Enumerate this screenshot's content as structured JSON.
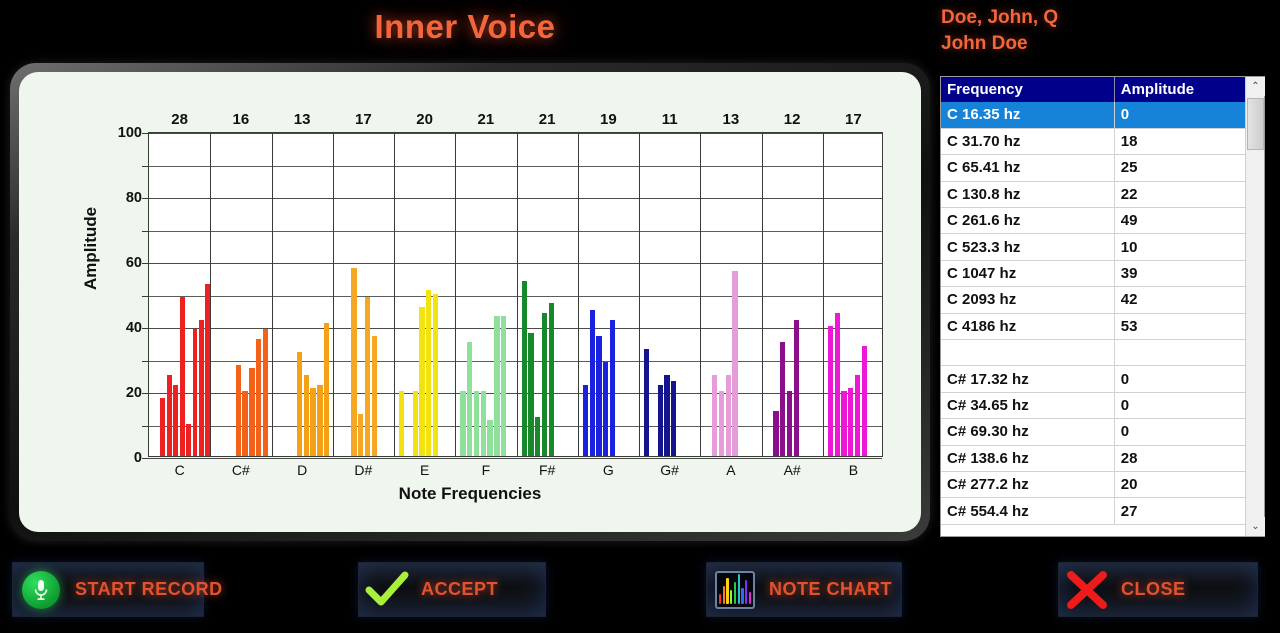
{
  "window": {
    "title": "Inner Voice",
    "title_color": "#F4653C",
    "background": "#000000"
  },
  "patient": {
    "name_formal": "Doe, John, Q",
    "name_display": "John Doe",
    "color": "#F4653C"
  },
  "chart_data": {
    "type": "bar",
    "title": "",
    "xlabel": "Note Frequencies",
    "ylabel": "Amplitude",
    "ylim": [
      0,
      100
    ],
    "yticks": [
      0,
      20,
      40,
      60,
      80,
      100
    ],
    "minor_tick_step": 10,
    "grid": true,
    "legend": "none",
    "categories": [
      "C",
      "C#",
      "D",
      "D#",
      "E",
      "F",
      "F#",
      "G",
      "G#",
      "A",
      "A#",
      "B"
    ],
    "group_top_labels": [
      28,
      16,
      13,
      17,
      20,
      21,
      21,
      19,
      11,
      13,
      12,
      17
    ],
    "group_colors": [
      "#EE2020",
      "#F4611A",
      "#F59A14",
      "#F5A623",
      "#F2E310",
      "#8FE09A",
      "#18892A",
      "#1A22E0",
      "#14158C",
      "#E59CD8",
      "#8B0E8B",
      "#EC18D6"
    ],
    "series": [
      {
        "name": "C",
        "color": "#EE2020",
        "values": [
          0,
          18,
          25,
          22,
          49,
          10,
          39,
          42,
          53
        ]
      },
      {
        "name": "C#",
        "color": "#F4611A",
        "values": [
          0,
          0,
          0,
          28,
          20,
          27,
          36,
          39
        ]
      },
      {
        "name": "D",
        "color": "#F5A118",
        "values": [
          0,
          0,
          0,
          32,
          25,
          21,
          22,
          41
        ]
      },
      {
        "name": "D#",
        "color": "#F5A623",
        "values": [
          0,
          0,
          58,
          13,
          49,
          37,
          0
        ]
      },
      {
        "name": "E",
        "color": "#F2E310",
        "values": [
          20,
          0,
          20,
          46,
          51,
          50
        ]
      },
      {
        "name": "F",
        "color": "#8FE09A",
        "values": [
          20,
          35,
          20,
          20,
          11,
          43,
          43
        ]
      },
      {
        "name": "F#",
        "color": "#18892A",
        "values": [
          54,
          38,
          12,
          44,
          47
        ]
      },
      {
        "name": "G",
        "color": "#1A22E0",
        "values": [
          22,
          45,
          37,
          29,
          42
        ]
      },
      {
        "name": "G#",
        "color": "#14158C",
        "values": [
          33,
          0,
          22,
          25,
          23
        ]
      },
      {
        "name": "A",
        "color": "#E59CD8",
        "values": [
          0,
          25,
          20,
          25,
          57
        ]
      },
      {
        "name": "A#",
        "color": "#8B0E8B",
        "values": [
          0,
          14,
          35,
          20,
          42
        ]
      },
      {
        "name": "B",
        "color": "#EC18D6",
        "values": [
          40,
          44,
          20,
          21,
          25,
          34
        ]
      }
    ]
  },
  "grid_table": {
    "columns": [
      "Frequency",
      "Amplitude"
    ],
    "header_bg": "#00008B",
    "selection_bg": "#1683D8",
    "selected_index": 0,
    "rows": [
      {
        "frequency": "C 16.35 hz",
        "amplitude": "0"
      },
      {
        "frequency": "C 31.70 hz",
        "amplitude": "18"
      },
      {
        "frequency": "C 65.41 hz",
        "amplitude": "25"
      },
      {
        "frequency": "C 130.8 hz",
        "amplitude": "22"
      },
      {
        "frequency": "C 261.6 hz",
        "amplitude": "49"
      },
      {
        "frequency": "C 523.3 hz",
        "amplitude": "10"
      },
      {
        "frequency": "C 1047 hz",
        "amplitude": "39"
      },
      {
        "frequency": "C 2093 hz",
        "amplitude": "42"
      },
      {
        "frequency": "C 4186 hz",
        "amplitude": "53"
      },
      {
        "frequency": "",
        "amplitude": ""
      },
      {
        "frequency": "C# 17.32 hz",
        "amplitude": "0"
      },
      {
        "frequency": "C# 34.65 hz",
        "amplitude": "0"
      },
      {
        "frequency": "C# 69.30 hz",
        "amplitude": "0"
      },
      {
        "frequency": "C# 138.6 hz",
        "amplitude": "28"
      },
      {
        "frequency": "C# 277.2 hz",
        "amplitude": "20"
      },
      {
        "frequency": "C# 554.4 hz",
        "amplitude": "27"
      }
    ],
    "scrollbar": {
      "up_arrow": "⌃",
      "down_arrow": "⌄"
    }
  },
  "buttons": [
    {
      "id": "start-record",
      "label": "START RECORD",
      "icon": "microphone-icon"
    },
    {
      "id": "accept",
      "label": "ACCEPT",
      "icon": "checkmark-icon"
    },
    {
      "id": "note-chart",
      "label": "NOTE CHART",
      "icon": "equalizer-icon"
    },
    {
      "id": "close",
      "label": "CLOSE",
      "icon": "x-mark-icon"
    }
  ]
}
